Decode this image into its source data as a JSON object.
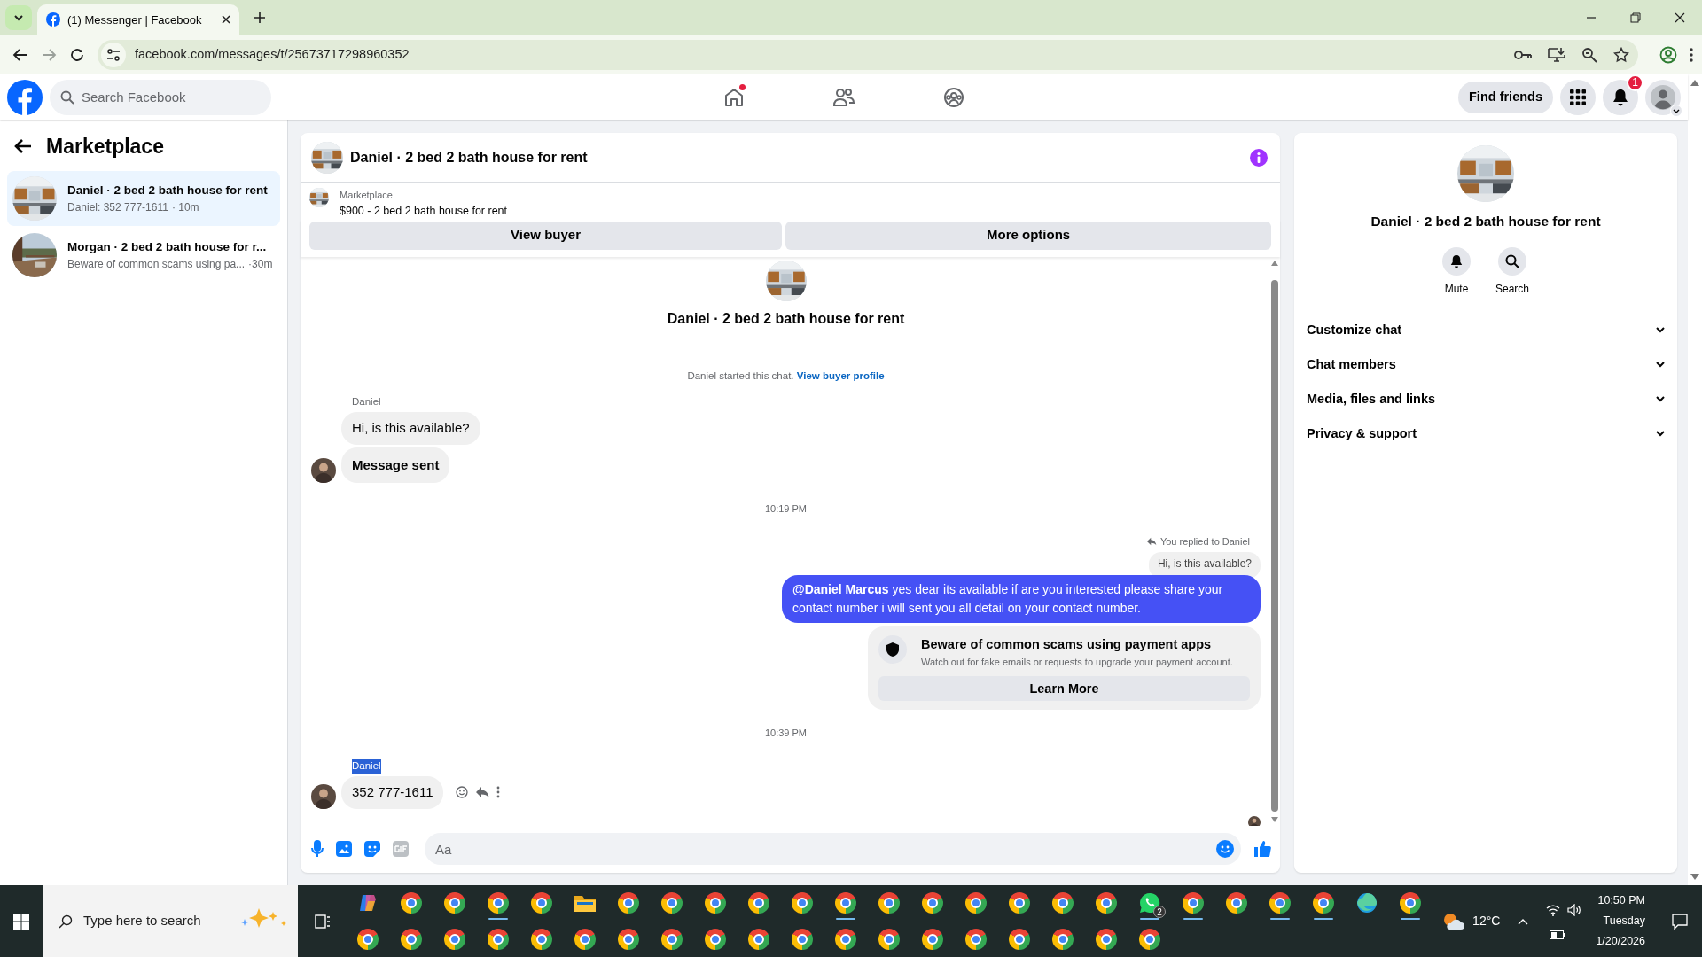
{
  "browser": {
    "tab_title": "(1) Messenger | Facebook",
    "url": "facebook.com/messages/t/25673717298960352"
  },
  "header": {
    "search_placeholder": "Search Facebook",
    "home_alert": true,
    "find_friends": "Find friends",
    "notification_count": "1"
  },
  "sidebar": {
    "title": "Marketplace",
    "chats": [
      {
        "title": "Daniel · 2 bed 2 bath house for rent",
        "preview": "Daniel: 352 777-1611",
        "time": "· 10m",
        "selected": true
      },
      {
        "title": "Morgan · 2 bed 2 bath house for r...",
        "preview": "Beware of common scams using pa...",
        "time": "·30m",
        "selected": false
      }
    ]
  },
  "chat": {
    "title": "Daniel · 2 bed 2 bath house for rent",
    "listing_label": "Marketplace",
    "listing_text": "$900 - 2 bed 2 bath house for rent",
    "buttons": [
      "View buyer",
      "More options"
    ],
    "intro_title": "Daniel · 2 bed 2 bath house for rent",
    "intro_text": "Daniel started this chat.",
    "intro_link": "View buyer profile",
    "messages": [
      {
        "kind": "sender",
        "text": "Daniel",
        "highlighted": false
      },
      {
        "kind": "incoming",
        "text": "Hi, is this available?",
        "bold": false,
        "avatar": false,
        "actions": false
      },
      {
        "kind": "incoming",
        "text": "Message sent",
        "bold": true,
        "avatar": true,
        "actions": false
      },
      {
        "kind": "time",
        "text": "10:19 PM"
      },
      {
        "kind": "reply_note",
        "text": "You replied to Daniel"
      },
      {
        "kind": "quoted",
        "text": "Hi, is this available?"
      },
      {
        "kind": "outgoing",
        "text": "**@Daniel Marcus** yes dear its available if are you interested please share your contact number i will sent you all detail on your contact number."
      },
      {
        "kind": "warning",
        "title": "Beware of common scams using payment apps",
        "text": "Watch out for fake emails or requests to upgrade your payment account.",
        "button": "Learn More"
      },
      {
        "kind": "time",
        "text": "10:39 PM"
      },
      {
        "kind": "sender",
        "text": "Daniel",
        "highlighted": true
      },
      {
        "kind": "incoming",
        "text": "352 777-1611",
        "bold": false,
        "avatar": true,
        "actions": true
      },
      {
        "kind": "seen"
      }
    ],
    "composer_placeholder": "Aa"
  },
  "details": {
    "name": "Daniel · 2 bed 2 bath house for rent",
    "actions": [
      {
        "kind": "mute",
        "label": "Mute"
      },
      {
        "kind": "search",
        "label": "Search"
      }
    ],
    "sections": [
      {
        "label": "Customize chat",
        "expanded": false
      },
      {
        "label": "Chat members",
        "expanded": false
      },
      {
        "label": "Media, files and links",
        "expanded": false
      },
      {
        "label": "Privacy & support",
        "expanded": false
      }
    ]
  },
  "taskbar": {
    "search_placeholder": "Type here to search",
    "row_1": [
      {
        "kind": "copilot",
        "open": false
      },
      {
        "kind": "chrome",
        "open": false
      },
      {
        "kind": "chrome",
        "open": false
      },
      {
        "kind": "chrome",
        "open": true
      },
      {
        "kind": "chrome",
        "open": false
      },
      {
        "kind": "explorer",
        "open": false
      },
      {
        "kind": "chrome",
        "open": false
      },
      {
        "kind": "chrome",
        "open": false
      },
      {
        "kind": "chrome",
        "open": false
      },
      {
        "kind": "chrome",
        "open": false
      },
      {
        "kind": "chrome",
        "open": false
      },
      {
        "kind": "chrome",
        "open": true
      },
      {
        "kind": "chrome",
        "open": false
      },
      {
        "kind": "chrome",
        "open": false
      },
      {
        "kind": "chrome",
        "open": false
      },
      {
        "kind": "chrome",
        "open": false
      },
      {
        "kind": "chrome",
        "open": false
      },
      {
        "kind": "chrome",
        "open": false
      },
      {
        "kind": "whatsapp",
        "open": true,
        "badge": "2"
      },
      {
        "kind": "chrome",
        "open": true
      },
      {
        "kind": "chrome",
        "open": false
      },
      {
        "kind": "chrome",
        "open": true
      },
      {
        "kind": "chrome",
        "open": true
      },
      {
        "kind": "edge",
        "open": false
      },
      {
        "kind": "chrome",
        "open": true
      }
    ],
    "row_2": [
      {
        "kind": "chrome",
        "open": false
      },
      {
        "kind": "chrome",
        "open": false
      },
      {
        "kind": "chrome",
        "open": false
      },
      {
        "kind": "chrome",
        "open": false
      },
      {
        "kind": "chrome",
        "open": false
      },
      {
        "kind": "chrome",
        "open": false
      },
      {
        "kind": "chrome",
        "open": false
      },
      {
        "kind": "chrome",
        "open": false
      },
      {
        "kind": "chrome",
        "open": false
      },
      {
        "kind": "chrome",
        "open": false
      },
      {
        "kind": "chrome",
        "open": false
      },
      {
        "kind": "chrome",
        "open": false
      },
      {
        "kind": "chrome",
        "open": false
      },
      {
        "kind": "chrome",
        "open": false
      },
      {
        "kind": "chrome",
        "open": false
      },
      {
        "kind": "chrome",
        "open": false
      },
      {
        "kind": "chrome",
        "open": false
      },
      {
        "kind": "chrome",
        "open": false
      },
      {
        "kind": "chrome",
        "open": false
      }
    ],
    "temperature": "12°C",
    "time": "10:50 PM",
    "day": "Tuesday",
    "date": "1/20/2026"
  }
}
